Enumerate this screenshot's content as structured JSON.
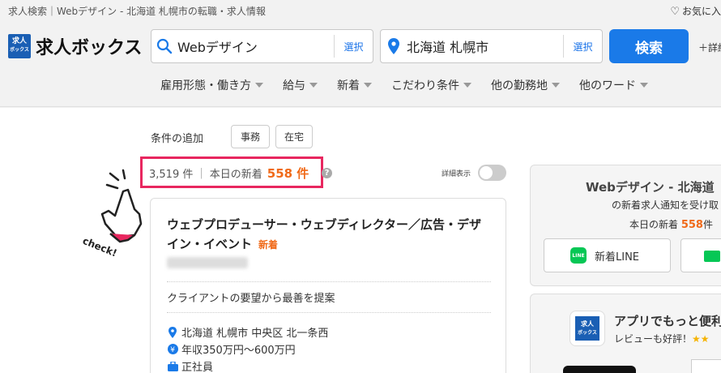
{
  "header": {
    "breadcrumb": "求人検索｜Webデザイン - 北海道 札幌市の転職・求人情報",
    "favorite_label": "お気に入",
    "logo_text": "求人ボックス",
    "logo_box_text": "求人ボックス",
    "keyword_value": "Webデザイン",
    "keyword_select": "選択",
    "location_value": "北海道 札幌市",
    "location_select": "選択",
    "search_button": "検索",
    "detail_link": "＋詳細"
  },
  "nav": [
    {
      "label": "雇用形態・働き方"
    },
    {
      "label": "給与"
    },
    {
      "label": "新着"
    },
    {
      "label": "こだわり条件"
    },
    {
      "label": "他の勤務地"
    },
    {
      "label": "他のワード"
    }
  ],
  "conditions": {
    "label": "条件の追加",
    "chips": [
      "事務",
      "在宅"
    ]
  },
  "results": {
    "total": "3,519 件",
    "new_label": "本日の新着",
    "new_count": "558 件",
    "help": "?",
    "detail_toggle_label": "詳細表示"
  },
  "check_label": "check!",
  "job": {
    "title": "ウェブプロデューサー・ウェブディレクター／広告・デザイン・イベント",
    "new_badge": "新着",
    "catch": "クライアントの要望から最善を提案",
    "location": "北海道 札幌市 中央区 北一条西",
    "salary": "年収350万円〜600万円",
    "employment": "正社員"
  },
  "side_notify": {
    "title": "Webデザイン - 北海道",
    "subtitle": "の新着求人通知を受け取",
    "new_label": "本日の新着",
    "new_count": "558",
    "new_unit": "件",
    "line_button": "新着LINE"
  },
  "side_app": {
    "title": "アプリでもっと便利",
    "review": "レビューも好評！",
    "stars": "★★",
    "logo_text": "求人ボックス"
  },
  "colors": {
    "accent": "#1a7ae8",
    "highlight": "#e8275f",
    "new": "#f06a19",
    "line": "#06c755"
  }
}
